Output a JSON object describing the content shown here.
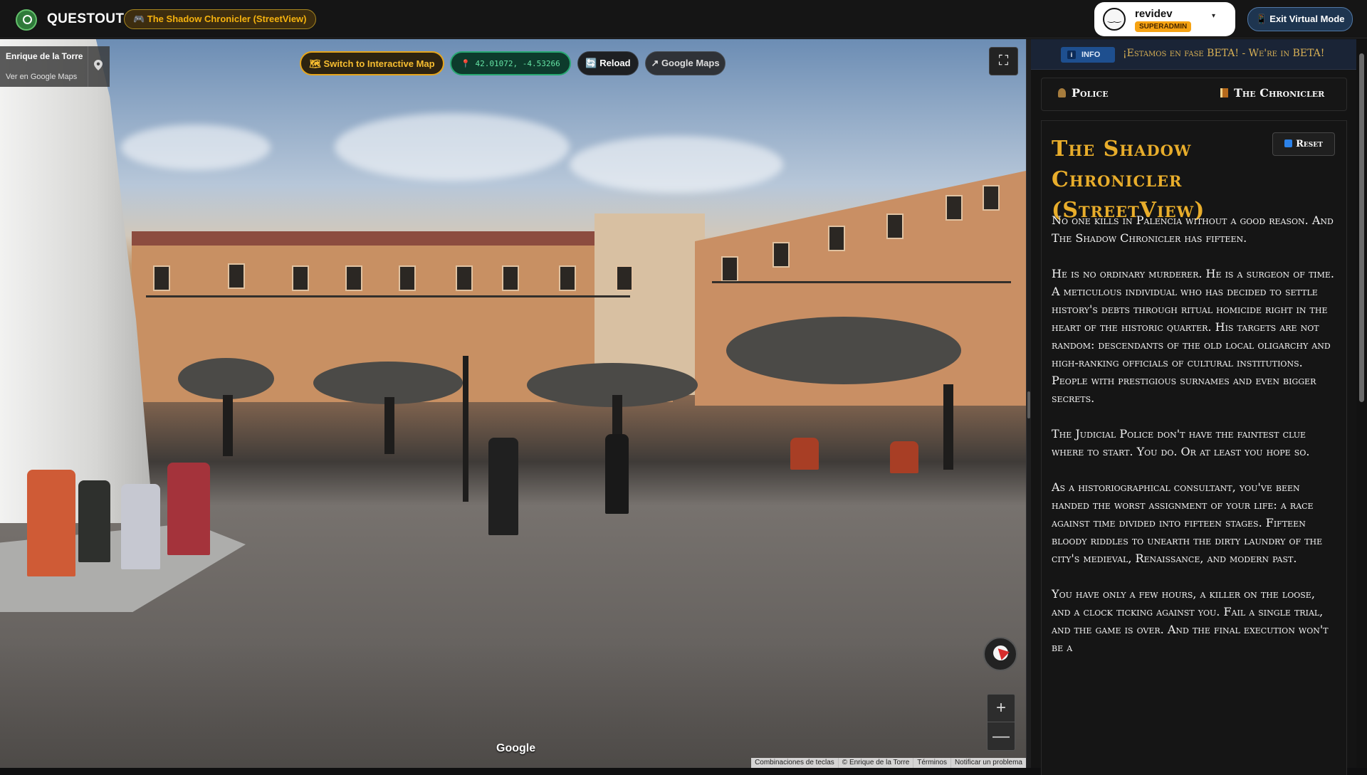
{
  "topbar": {
    "brand": "QUESTOUT",
    "active_quest": "🎮 The Shadow Chronicler (StreetView)",
    "user": {
      "name": "revidev",
      "role": "SUPERADMIN",
      "avatar_icon": "smiley-avatar-icon",
      "caret_icon": "chevron-down-icon"
    },
    "exit_label": "📱 Exit Virtual Mode",
    "accent_colors": {
      "brand_green": "#2f7a3a",
      "quest_gold": "#f5b20f",
      "admin_orange": "#f6a313"
    }
  },
  "streetview": {
    "location": {
      "title": "Enrique de la Torre",
      "link": "Ver en Google Maps"
    },
    "controls": {
      "interactive_map": "🗺 Switch to Interactive Map",
      "coordinates": "📍 42.01072, -4.53266",
      "reload": "🔄 Reload",
      "google_maps": "↗ Google Maps",
      "fullscreen_icon": "⛶",
      "zoom_in": "+",
      "zoom_out": "—"
    },
    "google_mark": "Google",
    "footer_links": [
      "Combinaciones de teclas",
      "© Enrique de la Torre",
      "Términos",
      "Notificar un problema"
    ]
  },
  "sidebar": {
    "info": {
      "badge": "INFO",
      "icon": "i",
      "message": "¡Estamos en fase BETA! - We're in BETA!"
    },
    "tabs": {
      "police": "Police",
      "chronicler": "The Chronicler"
    },
    "story": {
      "title": "The Shadow Chronicler (StreetView)",
      "reset": "Reset",
      "paragraphs": [
        "No one kills in Palencia without a good reason. And The Shadow Chronicler has fifteen.",
        "He is no ordinary murderer. He is a surgeon of time. A meticulous individual who has decided to settle history's debts through ritual homicide right in the heart of the historic quarter. His targets are not random: descendants of the old local oligarchy and high-ranking officials of cultural institutions. People with prestigious surnames and even bigger secrets.",
        "The Judicial Police don't have the faintest clue where to start. You do. Or at least you hope so.",
        "As a historiographical consultant, you've been handed the worst assignment of your life: a race against time divided into fifteen stages. Fifteen bloody riddles to unearth the dirty laundry of the city's medieval, Renaissance, and modern past.",
        "You have only a few hours, a killer on the loose, and a clock ticking against you. Fail a single trial, and the game is over. And the final execution won't be a"
      ]
    }
  }
}
